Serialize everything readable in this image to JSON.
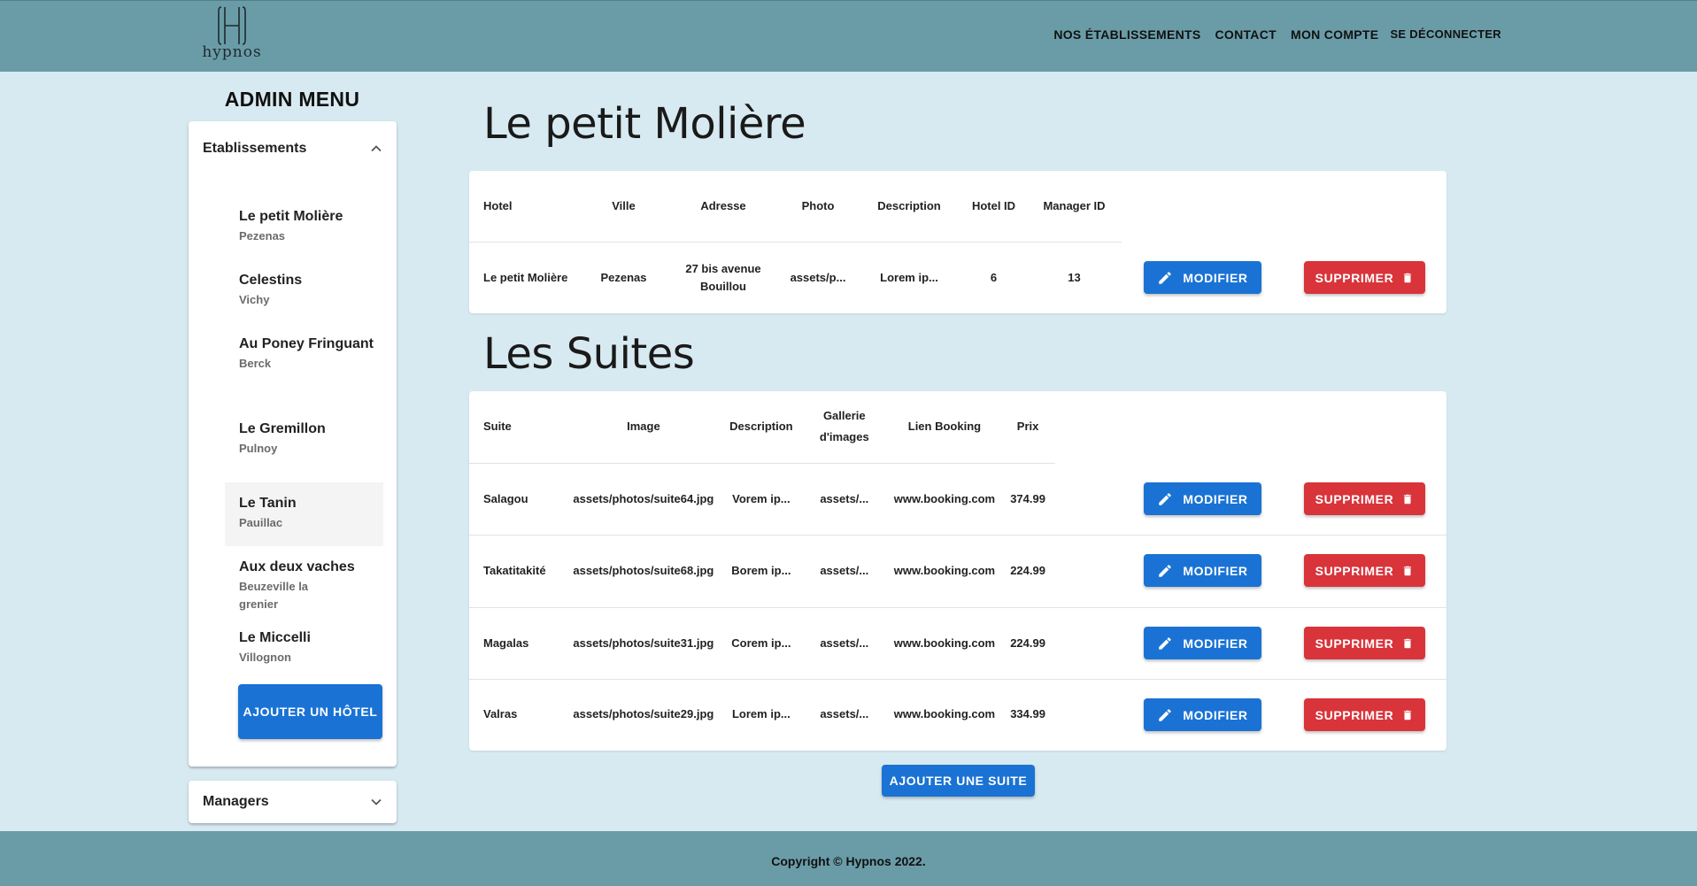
{
  "header": {
    "logo_text": "hypnos",
    "nav": [
      "NOS ÉTABLISSEMENTS",
      "CONTACT",
      "MON COMPTE",
      "SE DÉCONNECTER"
    ]
  },
  "sidebar": {
    "title": "ADMIN MENU",
    "etablissements_label": "Etablissements",
    "hotels": [
      {
        "name": "Le petit Molière",
        "city": "Pezenas"
      },
      {
        "name": "Celestins",
        "city": "Vichy"
      },
      {
        "name": "Au Poney Fringuant",
        "city": "Berck"
      },
      {
        "name": "Le Gremillon",
        "city": "Pulnoy"
      },
      {
        "name": "Le Tanin",
        "city": "Pauillac"
      },
      {
        "name": "Aux deux vaches",
        "city": "Beuzeville la grenier"
      },
      {
        "name": "Le Miccelli",
        "city": "Villognon"
      }
    ],
    "active_hotel_index": 4,
    "add_hotel_label": "AJOUTER UN HÔTEL",
    "managers_label": "Managers"
  },
  "hotel_section": {
    "title": "Le petit Molière",
    "columns": [
      "Hotel",
      "Ville",
      "Adresse",
      "Photo",
      "Description",
      "Hotel ID",
      "Manager ID"
    ],
    "row": {
      "hotel": "Le petit Molière",
      "ville": "Pezenas",
      "adresse": "27 bis avenue Bouillou",
      "photo": "assets/p...",
      "description": "Lorem ip...",
      "hotel_id": "6",
      "manager_id": "13"
    }
  },
  "suites_section": {
    "title": "Les Suites",
    "columns": [
      "Suite",
      "Image",
      "Description",
      "Gallerie d'images",
      "Lien Booking",
      "Prix"
    ],
    "rows": [
      {
        "suite": "Salagou",
        "image": "assets/photos/suite64.jpg",
        "description": "Vorem ip...",
        "gallery": "assets/...",
        "booking": "www.booking.com",
        "prix": "374.99"
      },
      {
        "suite": "Takatitakité",
        "image": "assets/photos/suite68.jpg",
        "description": "Borem ip...",
        "gallery": "assets/...",
        "booking": "www.booking.com",
        "prix": "224.99"
      },
      {
        "suite": "Magalas",
        "image": "assets/photos/suite31.jpg",
        "description": "Corem ip...",
        "gallery": "assets/...",
        "booking": "www.booking.com",
        "prix": "224.99"
      },
      {
        "suite": "Valras",
        "image": "assets/photos/suite29.jpg",
        "description": "Lorem ip...",
        "gallery": "assets/...",
        "booking": "www.booking.com",
        "prix": "334.99"
      }
    ],
    "add_suite_label": "AJOUTER UNE SUITE"
  },
  "buttons": {
    "modifier": "MODIFIER",
    "supprimer": "SUPPRIMER"
  },
  "footer": {
    "copyright": "Copyright © Hypnos 2022."
  },
  "colors": {
    "header_bg": "#6a9ca8",
    "page_bg": "#d8eaf1",
    "primary": "#1a73d4",
    "danger": "#d8343a"
  }
}
